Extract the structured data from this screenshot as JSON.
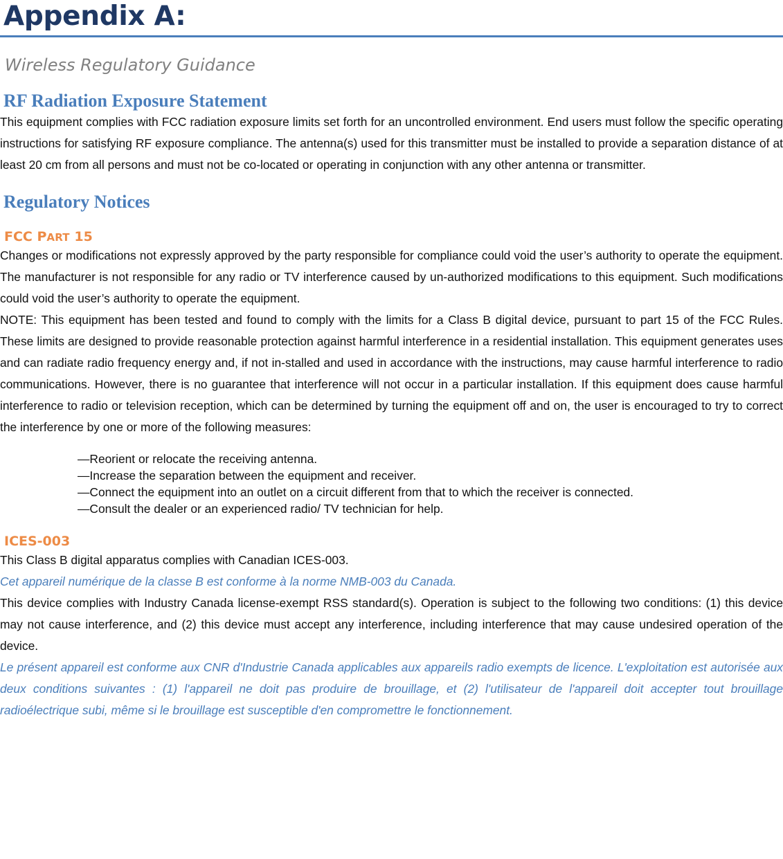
{
  "document": {
    "title": "Appendix A:",
    "subtitle": "Wireless Regulatory Guidance"
  },
  "sections": {
    "rf_exposure": {
      "heading": "RF Radiation Exposure Statement",
      "body": "This equipment complies with FCC radiation exposure limits set forth for an uncontrolled environment. End users must follow the specific operating instructions for satisfying RF exposure compliance. The antenna(s) used for this transmitter must be installed to provide a separation distance of at least 20 cm from all persons and must not be co-located or operating in conjunction with any other antenna or transmitter."
    },
    "regulatory_notices": {
      "heading": "Regulatory Notices"
    },
    "fcc_part_15": {
      "heading_main": "FCC P",
      "heading_smallcaps": "ART",
      "heading_tail": " 15",
      "heading_full": "FCC PART 15",
      "paragraph_1": "Changes or modifications not expressly approved by the party responsible for compliance could void the user’s authority to operate the equipment. The manufacturer is not responsible for any radio or TV interference caused by un-authorized modifications to this equipment. Such modifications could void the user’s authority to operate the equipment.",
      "paragraph_2": "NOTE: This equipment has been tested and found to comply with the limits for a Class B digital device, pursuant to part 15 of the FCC Rules. These limits are designed to provide reasonable protection against harmful interference in a residential installation. This equipment generates uses and can radiate radio frequency energy and, if not in-stalled and used in accordance with the instructions, may cause harmful interference to radio communications. However, there is no guarantee that interference will not occur in a particular installation. If this equipment does cause harmful interference to radio or television reception, which can be determined by turning the equipment off and on, the user is encouraged to try to correct the interference by one or more of the following measures:",
      "measures": [
        "—Reorient or relocate the receiving antenna.",
        "—Increase the separation between the equipment and receiver.",
        "—Connect the equipment into an outlet on a circuit different from that to which the receiver is connected.",
        "—Consult the dealer or an experienced radio/ TV technician for help."
      ]
    },
    "ices_003": {
      "heading": "ICES-003",
      "english_line": "This Class B digital apparatus complies with Canadian ICES-003.",
      "french_line": "Cet appareil numérique de la classe B est conforme à  la norme NMB-003 du Canada.",
      "rss_english": "This device complies with Industry Canada license-exempt RSS standard(s). Operation is subject to the following two conditions: (1) this device may not cause interference, and (2) this device must accept any interference, including interference that may cause undesired operation of the device.",
      "rss_french": "Le présent appareil est conforme aux CNR d'Industrie Canada applicables aux appareils radio exempts de licence. L'exploitation est autorisée aux deux conditions suivantes : (1) l'appareil ne doit pas produire de brouillage, et (2) l'utilisateur de l'appareil doit accepter tout brouillage radioélectrique subi, même si le brouillage est susceptible d'en compromettre le fonctionnement."
    }
  },
  "colors": {
    "title_navy": "#1F3864",
    "rule_blue": "#4A7EBB",
    "heading_blue": "#4A7EBB",
    "heading_orange": "#ED8B46",
    "subtitle_gray": "#808080",
    "body_black": "#111111"
  }
}
